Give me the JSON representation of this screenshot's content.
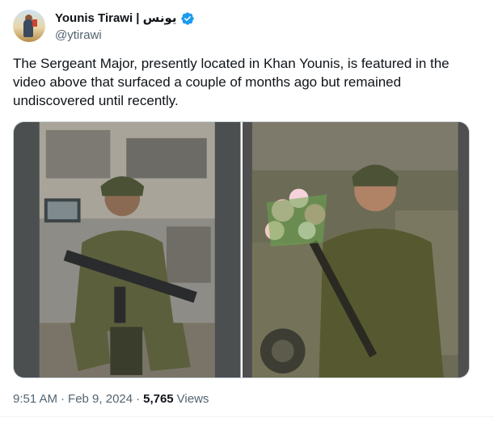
{
  "author": {
    "display_name": "Younis Tirawi | يونس",
    "handle": "@ytirawi",
    "verified": true
  },
  "tweet": {
    "text": "The Sergeant Major, presently located in Khan Younis, is featured in the video above that surfaced a couple of months ago but remained undiscovered until recently."
  },
  "media": {
    "count": 2
  },
  "meta": {
    "time": "9:51 AM",
    "sep1": "·",
    "date": "Feb 9, 2024",
    "sep2": "·",
    "views_count": "5,765",
    "views_label": "Views"
  },
  "colors": {
    "verified_blue": "#1d9bf0",
    "secondary_text": "#536471"
  }
}
